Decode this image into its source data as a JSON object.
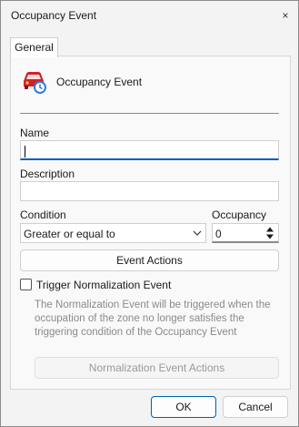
{
  "window": {
    "title": "Occupancy Event",
    "close_glyph": "×"
  },
  "tabs": [
    {
      "label": "General",
      "active": true
    }
  ],
  "header": {
    "title": "Occupancy Event",
    "icon": "car-occupancy-icon"
  },
  "form": {
    "name_label": "Name",
    "name_value": "",
    "description_label": "Description",
    "description_value": "",
    "condition_label": "Condition",
    "condition_value": "Greater or equal to",
    "occupancy_label": "Occupancy",
    "occupancy_value": "0",
    "event_actions_label": "Event Actions",
    "trigger_label": "Trigger Normalization Event",
    "trigger_checked": false,
    "trigger_description": "The Normalization Event will be triggered when the occupation of the zone no longer satisfies the triggering condition of the Occupancy Event",
    "normalization_actions_label": "Normalization Event Actions"
  },
  "footer": {
    "ok_label": "OK",
    "cancel_label": "Cancel"
  },
  "colors": {
    "accent": "#005fb8",
    "icon_red": "#d42027",
    "icon_blue": "#2f7fd6"
  }
}
